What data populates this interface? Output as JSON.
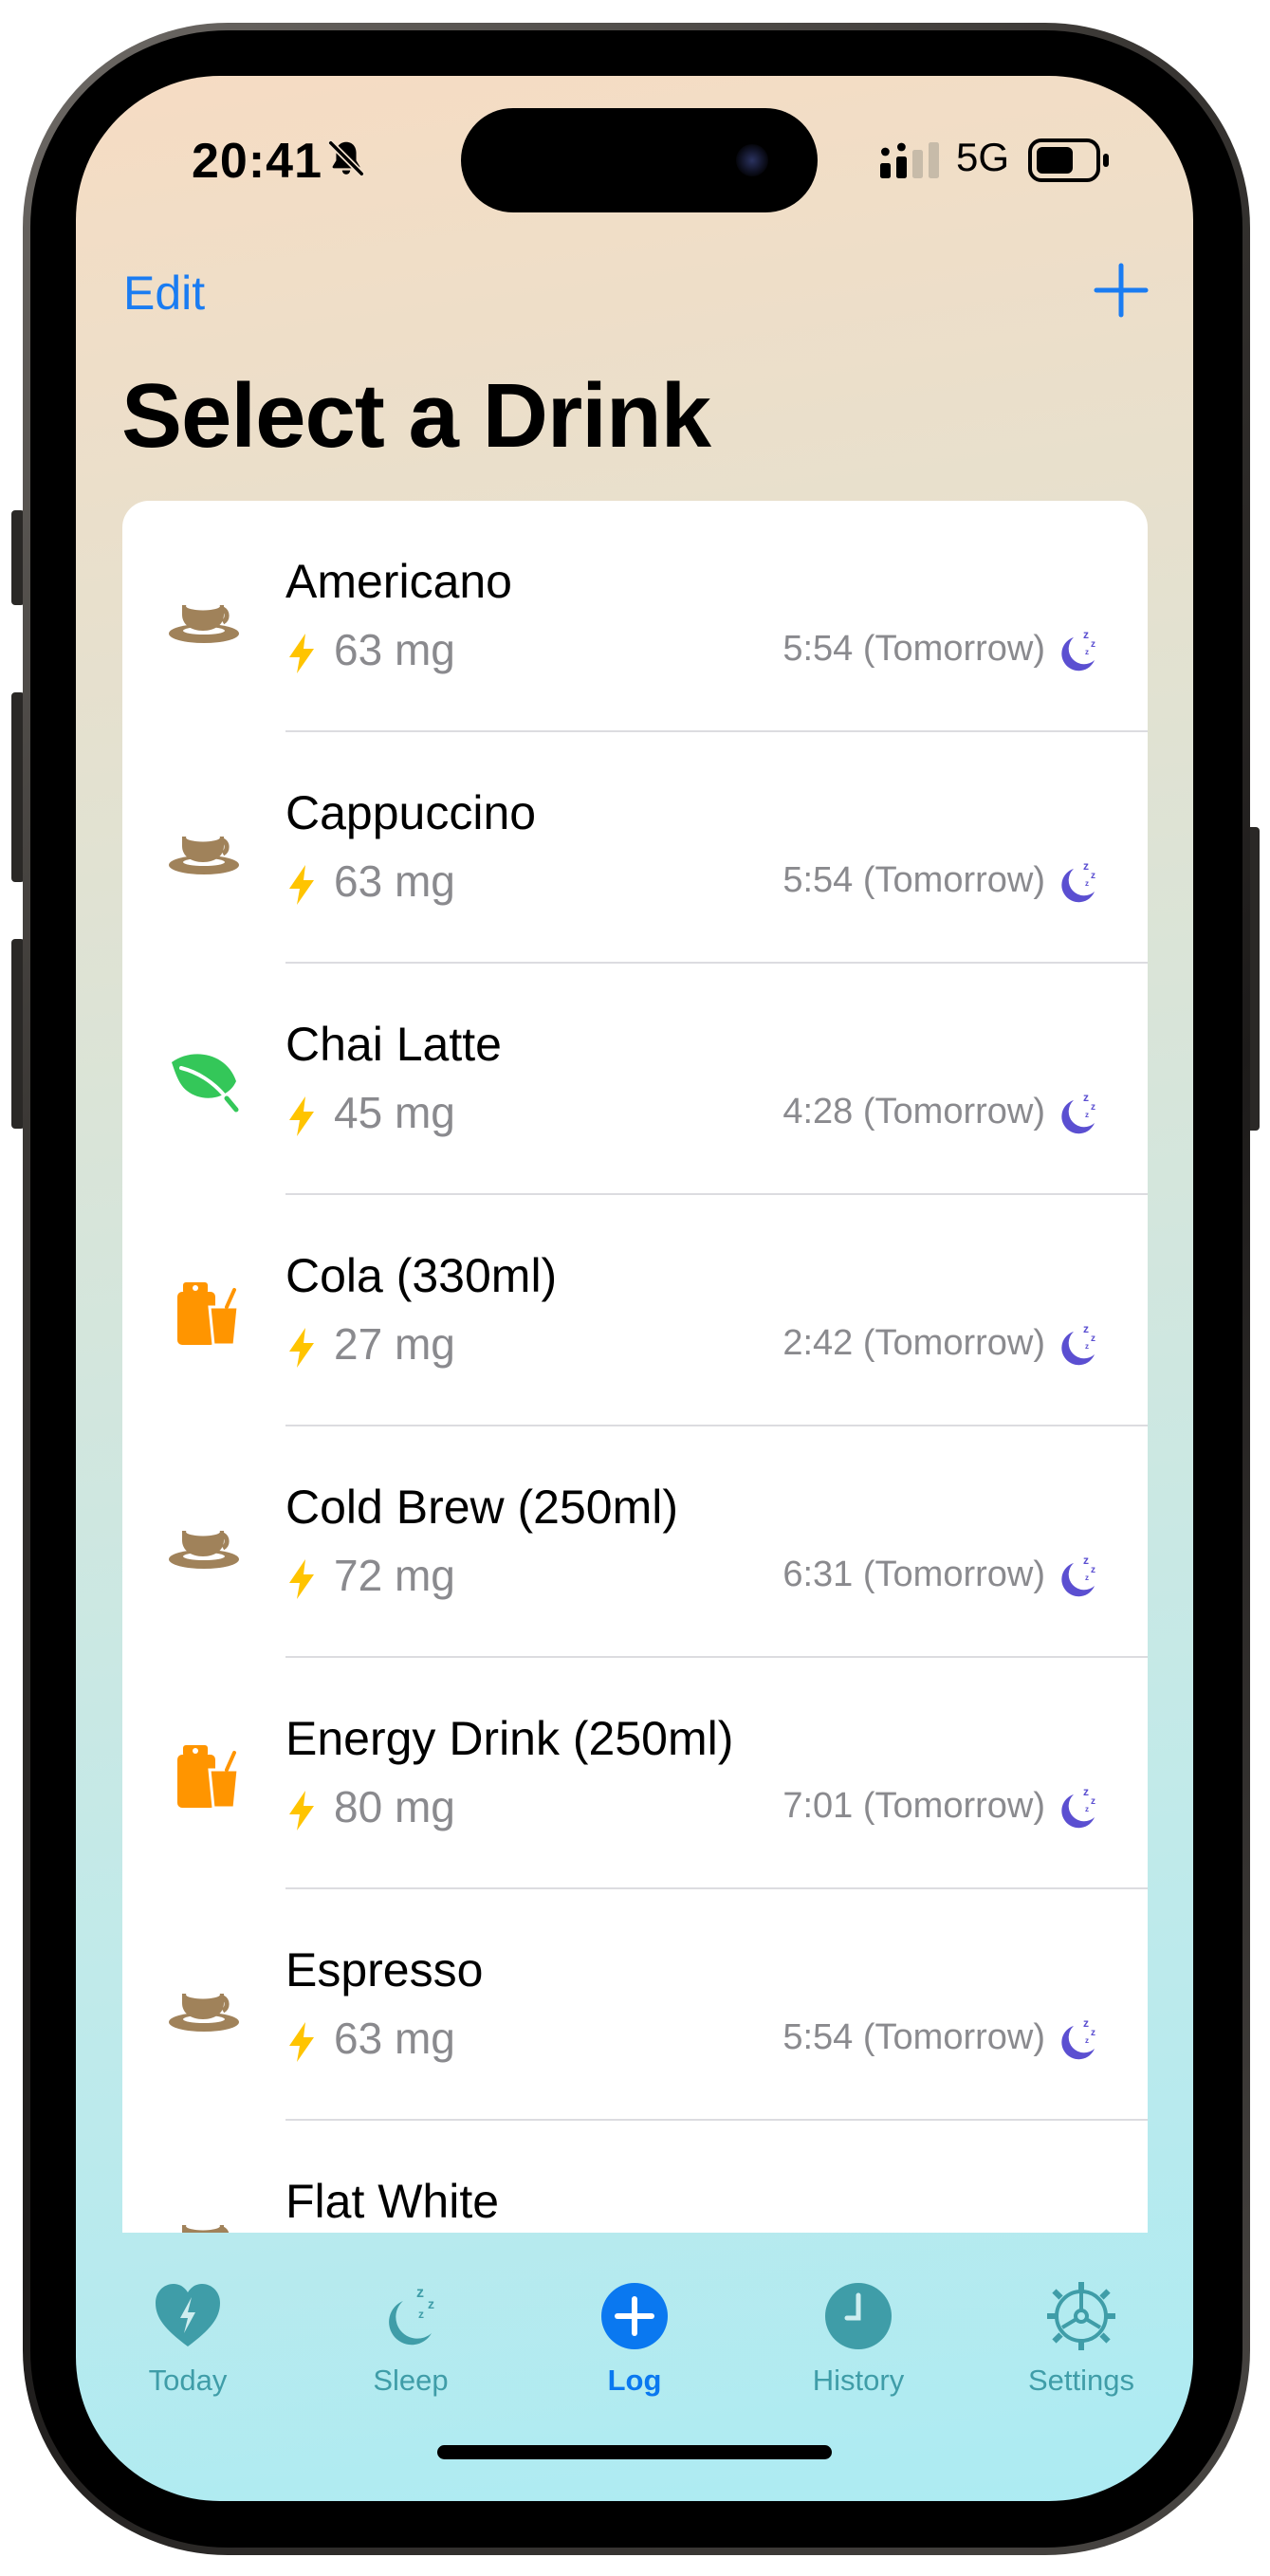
{
  "status_bar": {
    "time": "20:41",
    "network": "5G",
    "icons": [
      "bell-slash-icon",
      "signal-icon",
      "battery-icon"
    ]
  },
  "nav": {
    "edit_label": "Edit",
    "add_icon": "plus-icon",
    "title": "Select a Drink"
  },
  "drinks": [
    {
      "name": "Americano",
      "caffeine": "63 mg",
      "sleep_time": "5:54 (Tomorrow)",
      "icon": "coffee-cup-icon"
    },
    {
      "name": "Cappuccino",
      "caffeine": "63 mg",
      "sleep_time": "5:54 (Tomorrow)",
      "icon": "coffee-cup-icon"
    },
    {
      "name": "Chai Latte",
      "caffeine": "45 mg",
      "sleep_time": "4:28 (Tomorrow)",
      "icon": "leaf-icon"
    },
    {
      "name": "Cola (330ml)",
      "caffeine": "27 mg",
      "sleep_time": "2:42 (Tomorrow)",
      "icon": "soda-icon"
    },
    {
      "name": "Cold Brew (250ml)",
      "caffeine": "72 mg",
      "sleep_time": "6:31 (Tomorrow)",
      "icon": "coffee-cup-icon"
    },
    {
      "name": "Energy Drink (250ml)",
      "caffeine": "80 mg",
      "sleep_time": "7:01 (Tomorrow)",
      "icon": "soda-icon"
    },
    {
      "name": "Espresso",
      "caffeine": "63 mg",
      "sleep_time": "5:54 (Tomorrow)",
      "icon": "coffee-cup-icon"
    },
    {
      "name": "Flat White",
      "caffeine": "",
      "sleep_time": "",
      "icon": "coffee-cup-icon"
    }
  ],
  "tabs": [
    {
      "label": "Today",
      "icon": "heart-bolt-icon",
      "active": false
    },
    {
      "label": "Sleep",
      "icon": "moon-zzz-icon",
      "active": false
    },
    {
      "label": "Log",
      "icon": "plus-circle-icon",
      "active": true
    },
    {
      "label": "History",
      "icon": "clock-icon",
      "active": false
    },
    {
      "label": "Settings",
      "icon": "gear-icon",
      "active": false
    }
  ],
  "colors": {
    "accent": "#0a78f0",
    "tab_inactive": "#3f9da8",
    "coffee": "#a0825a",
    "leaf": "#34c759",
    "soda": "#ff9500",
    "bolt": "#ffc400",
    "moon": "#5b4fd1"
  }
}
